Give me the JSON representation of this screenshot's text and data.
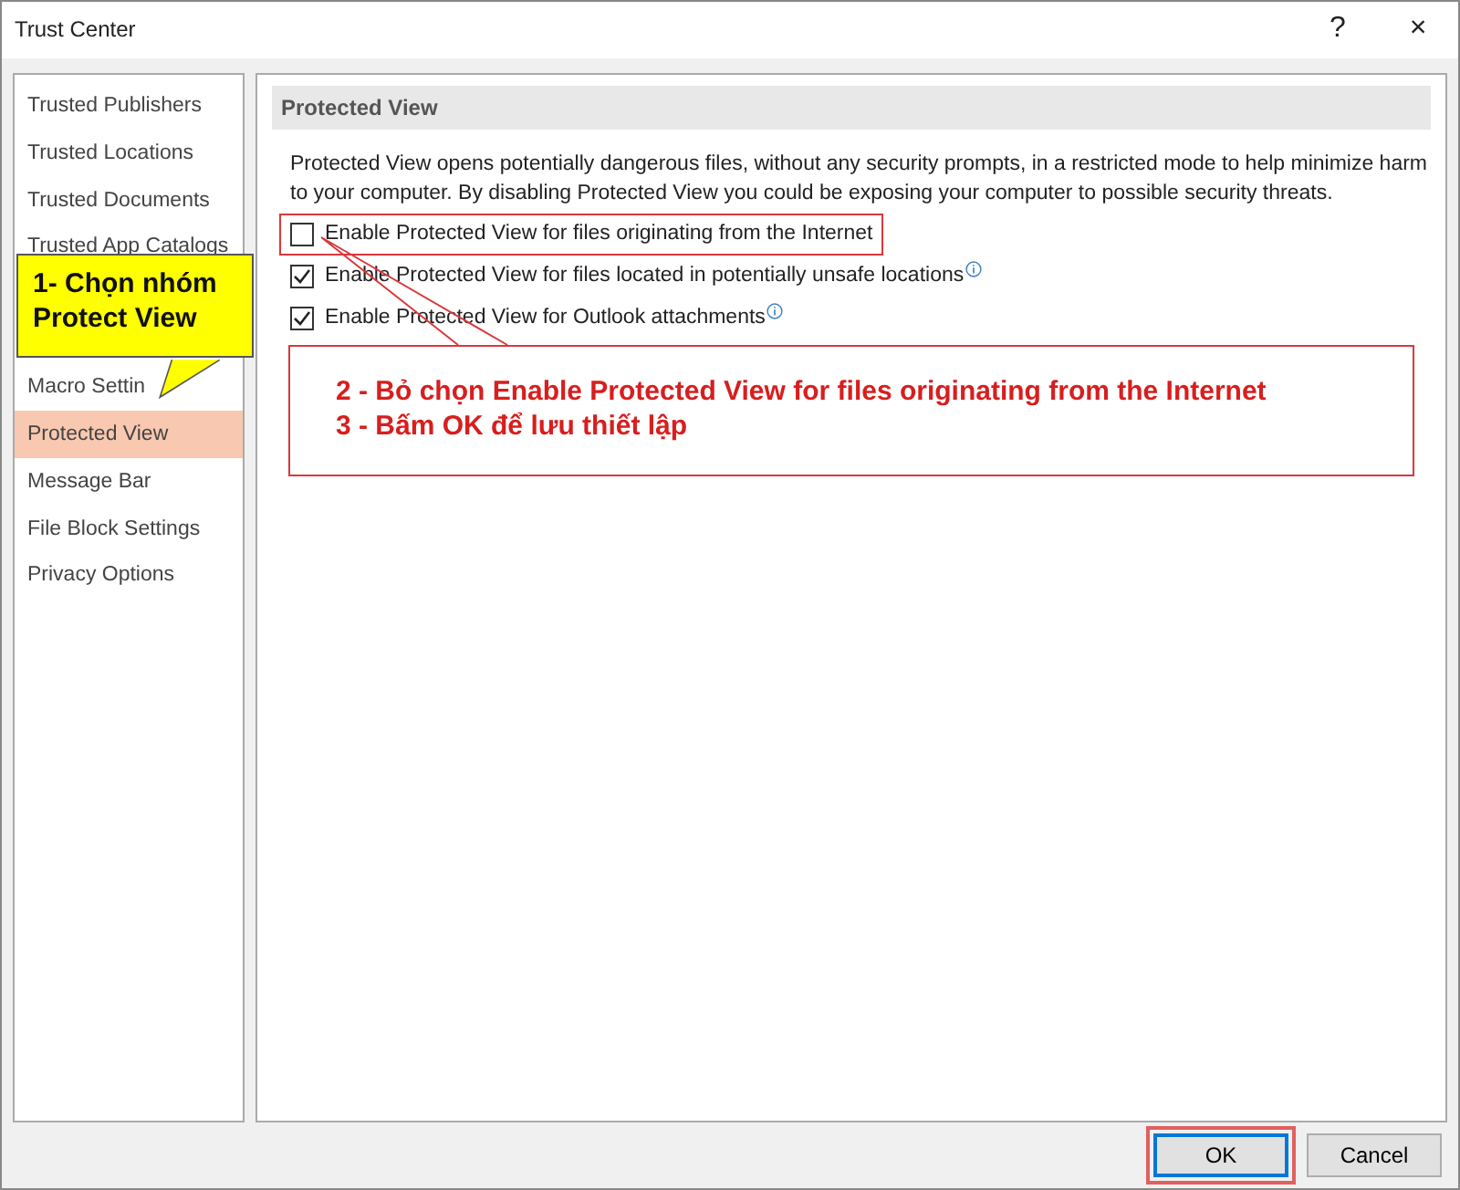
{
  "window": {
    "title": "Trust Center",
    "help_button": "?",
    "close_button": "×"
  },
  "sidebar": {
    "items": [
      {
        "label": "Trusted Publishers",
        "selected": false
      },
      {
        "label": "Trusted Locations",
        "selected": false
      },
      {
        "label": "Trusted Documents",
        "selected": false
      },
      {
        "label": "Trusted App Catalogs",
        "selected": false
      },
      {
        "label": "Macro Settin",
        "selected": false
      },
      {
        "label": "Protected View",
        "selected": true
      },
      {
        "label": "Message Bar",
        "selected": false
      },
      {
        "label": "File Block Settings",
        "selected": false
      },
      {
        "label": "Privacy Options",
        "selected": false
      }
    ]
  },
  "section": {
    "heading": "Protected View",
    "description": "Protected View opens potentially dangerous files, without any security prompts, in a restricted mode to help minimize harm to your computer. By disabling Protected View you could be exposing your computer to possible security threats.",
    "options": [
      {
        "label": "Enable Protected View for files originating from the Internet",
        "checked": false,
        "info_icon": false,
        "highlighted": true
      },
      {
        "label": "Enable Protected View for files located in potentially unsafe locations",
        "checked": true,
        "info_icon": true
      },
      {
        "label": "Enable Protected View for Outlook attachments",
        "checked": true,
        "info_icon": true
      }
    ]
  },
  "buttons": [
    {
      "label": "OK",
      "default": true,
      "highlighted": true
    },
    {
      "label": "Cancel",
      "default": false
    }
  ],
  "annotations": {
    "callout": [
      "1- Chọn nhóm",
      "Protect View"
    ],
    "note": [
      "2 - Bỏ chọn Enable Protected View for files originating from the Internet",
      "3 - Bấm OK để lưu thiết lập"
    ]
  }
}
